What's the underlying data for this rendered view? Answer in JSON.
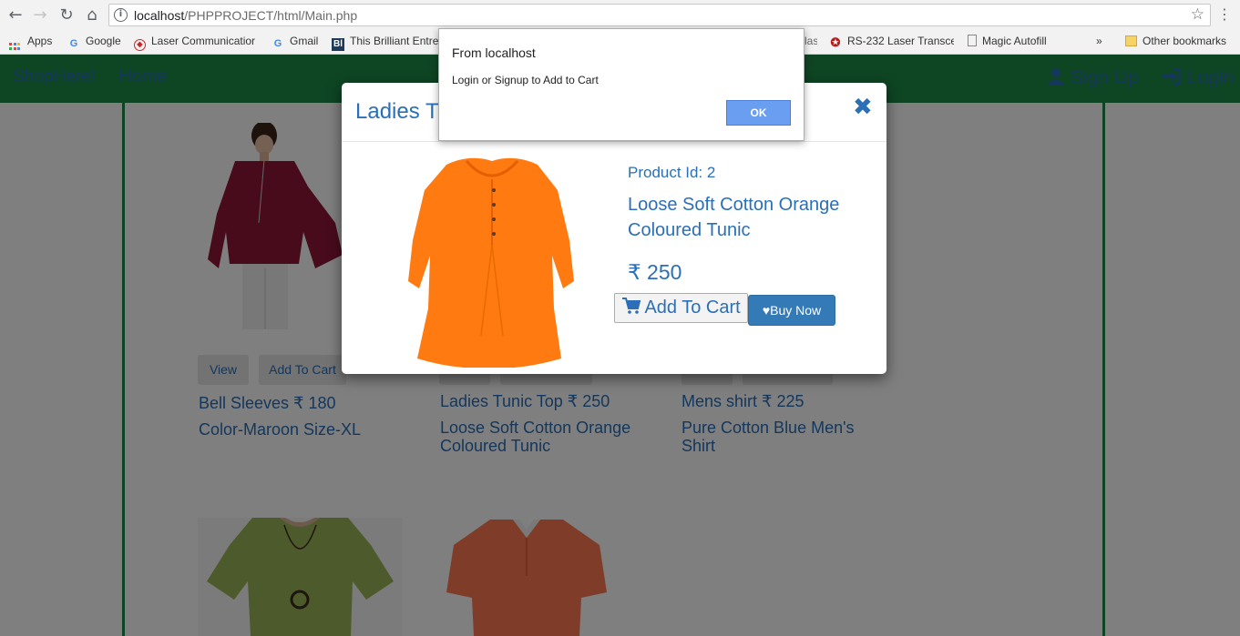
{
  "browser": {
    "url_host": "localhost",
    "url_path": "/PHPPROJECT/html/Main.php",
    "bookmarks": [
      {
        "label": "Apps"
      },
      {
        "label": "Google"
      },
      {
        "label": "Laser Communicatior"
      },
      {
        "label": "Gmail"
      },
      {
        "label": "This Brilliant Entre"
      },
      {
        "label": "las"
      },
      {
        "label": "RS-232 Laser Transce"
      },
      {
        "label": "Magic Autofill"
      },
      {
        "label": "»"
      },
      {
        "label": "Other bookmarks"
      }
    ]
  },
  "navbar": {
    "brand": "ShopHere!",
    "home": "Home",
    "signup": "Sign Up",
    "login": "Login",
    "color": "#1d8a46",
    "link_color": "#2a6fb8"
  },
  "products": [
    {
      "view": "View",
      "add": "Add To Cart",
      "title": "Bell Sleeves ₹ 180",
      "desc": "Color-Maroon Size-XL"
    },
    {
      "title": "Ladies Tunic Top ₹ 250",
      "desc": "Loose Soft Cotton Orange Coloured Tunic"
    },
    {
      "title": "Mens shirt ₹ 225",
      "desc": "Pure Cotton Blue Men's Shirt"
    }
  ],
  "modal": {
    "title": "Ladies T",
    "close_icon": "close-icon",
    "product_id": "Product Id: 2",
    "name": "Loose Soft Cotton Orange Coloured Tunic",
    "price": "₹ 250",
    "add_to_cart": "Add To Cart",
    "buy_now": "Buy Now"
  },
  "alert": {
    "title": "From localhost",
    "message": "Login or Signup to Add to Cart",
    "ok": "OK"
  }
}
